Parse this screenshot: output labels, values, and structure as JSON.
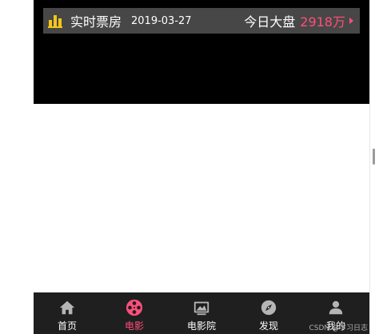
{
  "boxoffice": {
    "title": "实时票房",
    "date": "2019-03-27",
    "today_label": "今日大盘",
    "today_value": "2918万",
    "accent": "#ff4f7a",
    "icon_color": "#f5c518",
    "icons": {
      "chart": "bar-chart-icon",
      "arrow": "caret-right-icon"
    }
  },
  "tabbar": {
    "active_color": "#ff4f7a",
    "items": [
      {
        "label": "首页",
        "icon": "home-icon",
        "active": false
      },
      {
        "label": "电影",
        "icon": "film-reel-icon",
        "active": true
      },
      {
        "label": "电影院",
        "icon": "cinema-screen-icon",
        "active": false
      },
      {
        "label": "发现",
        "icon": "compass-icon",
        "active": false
      },
      {
        "label": "我的",
        "icon": "user-icon",
        "active": false
      }
    ]
  },
  "watermark": "CSDN @学习日志"
}
